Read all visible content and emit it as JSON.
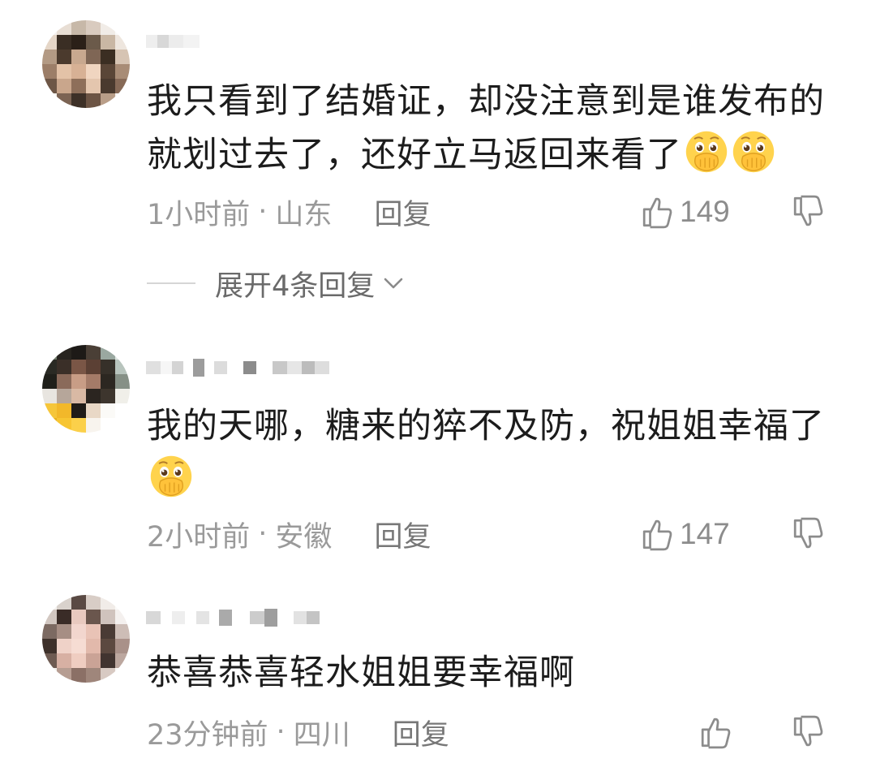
{
  "comments": [
    {
      "text": "我只看到了结婚证，却没注意到是谁发布的就划过去了，还好立马返回来看了",
      "emojis": [
        "covering-mouth-emoji",
        "covering-mouth-emoji"
      ],
      "time": "1小时前",
      "location": "山东",
      "reply_label": "回复",
      "likes": "149",
      "expand_label": "展开4条回复"
    },
    {
      "text": "我的天哪，糖来的猝不及防，祝姐姐幸福了",
      "emojis": [
        "covering-mouth-emoji"
      ],
      "time": "2小时前",
      "location": "安徽",
      "reply_label": "回复",
      "likes": "147"
    },
    {
      "text": "恭喜恭喜轻水姐姐要幸福啊",
      "emojis": [],
      "time": "23分钟前",
      "location": "四川",
      "reply_label": "回复",
      "likes": ""
    }
  ],
  "separator": "·",
  "icons": {
    "like": "thumbs-up-icon",
    "dislike": "thumbs-down-icon",
    "expand": "chevron-down-icon"
  },
  "colors": {
    "text": "#1c1c1c",
    "meta": "#9a9a9a",
    "reply": "#777777",
    "expand_text": "#6a6a6a"
  }
}
